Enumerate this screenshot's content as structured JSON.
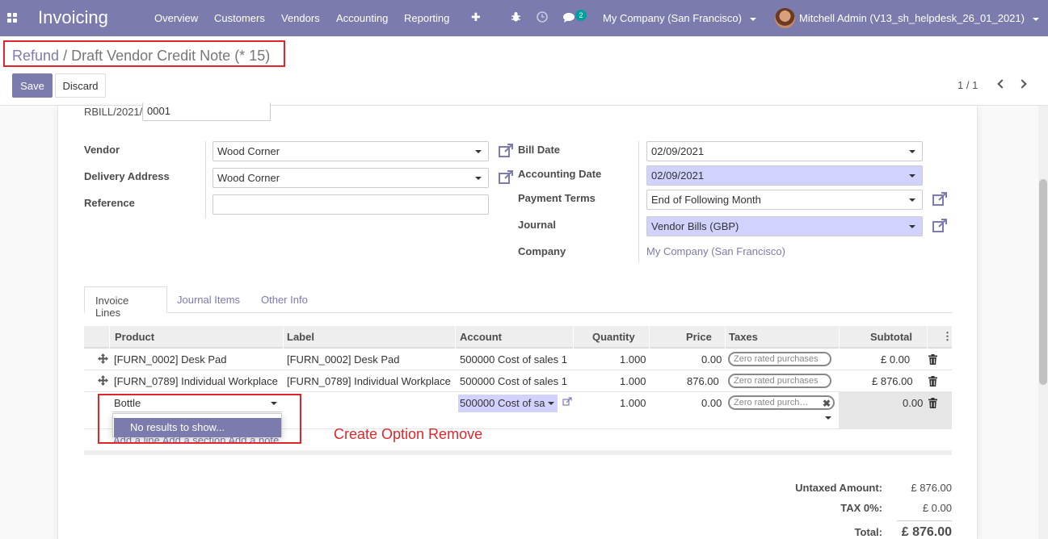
{
  "navbar": {
    "brand": "Invoicing",
    "menus": [
      "Overview",
      "Customers",
      "Vendors",
      "Accounting",
      "Reporting"
    ],
    "plus": "✚",
    "chat_count": "2",
    "company": "My Company (San Francisco)",
    "user": "Mitchell Admin (V13_sh_helpdesk_26_01_2021)"
  },
  "breadcrumb": {
    "parent": "Refund",
    "separator": "/",
    "current": "Draft Vendor Credit Note (* 15)"
  },
  "actions": {
    "save": "Save",
    "discard": "Discard"
  },
  "pager": {
    "value": "1 / 1"
  },
  "form": {
    "ref_prefix": "RBILL/2021/",
    "ref_number": "0001",
    "vendor_label": "Vendor",
    "vendor": "Wood Corner",
    "delivery_label": "Delivery Address",
    "delivery": "Wood Corner",
    "reference_label": "Reference",
    "reference": "",
    "bill_date_label": "Bill Date",
    "bill_date": "02/09/2021",
    "accounting_date_label": "Accounting Date",
    "accounting_date": "02/09/2021",
    "payment_terms_label": "Payment Terms",
    "payment_terms": "End of Following Month",
    "journal_label": "Journal",
    "journal": "Vendor Bills (GBP)",
    "company_label": "Company",
    "company": "My Company (San Francisco)"
  },
  "tabs": [
    "Invoice Lines",
    "Journal Items",
    "Other Info"
  ],
  "table": {
    "headers": {
      "product": "Product",
      "label": "Label",
      "account": "Account",
      "quantity": "Quantity",
      "price": "Price",
      "taxes": "Taxes",
      "subtotal": "Subtotal",
      "options": "⋮"
    },
    "rows": [
      {
        "product": "[FURN_0002] Desk Pad",
        "label": "[FURN_0002] Desk Pad",
        "account": "500000 Cost of sales 1",
        "quantity": "1.000",
        "price": "0.00",
        "tax": "Zero rated purchases",
        "subtotal": "£ 0.00"
      },
      {
        "product": "[FURN_0789] Individual Workplace",
        "label": "[FURN_0789] Individual Workplace",
        "account": "500000 Cost of sales 1",
        "quantity": "1.000",
        "price": "876.00",
        "tax": "Zero rated purchases",
        "subtotal": "£ 876.00"
      }
    ],
    "edit_row": {
      "product": "Bottle",
      "account": "500000 Cost of sa",
      "quantity": "1.000",
      "price": "0.00",
      "tax": "Zero rated purch…",
      "subtotal": "0.00"
    },
    "dropdown_item": "No results to show...",
    "add_links": "Add a line   Add a section   Add a note"
  },
  "annotation": "Create Option Remove",
  "totals": {
    "untaxed_label": "Untaxed Amount:",
    "untaxed": "£ 876.00",
    "tax_label": "TAX 0%:",
    "tax": "£ 0.00",
    "total_label": "Total:",
    "total": "£ 876.00"
  },
  "colors": {
    "primary": "#7c7bad",
    "highlight": "#e0262b",
    "required": "#d2d2ff"
  }
}
